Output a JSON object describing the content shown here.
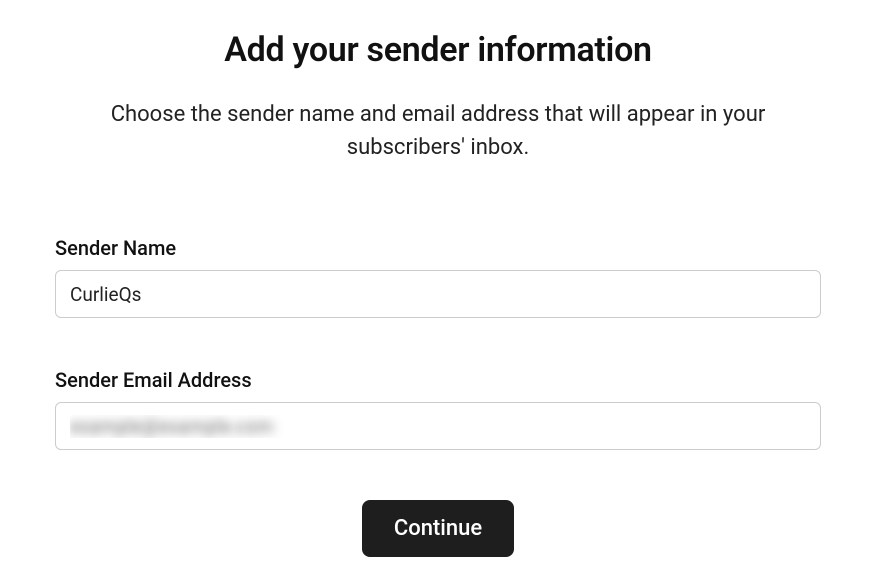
{
  "header": {
    "title": "Add your sender information",
    "subtitle": "Choose the sender name and email address that will appear in your subscribers' inbox."
  },
  "form": {
    "sender_name": {
      "label": "Sender Name",
      "value": "CurlieQs"
    },
    "sender_email": {
      "label": "Sender Email Address",
      "value": "example@example.com"
    }
  },
  "actions": {
    "continue_label": "Continue"
  }
}
